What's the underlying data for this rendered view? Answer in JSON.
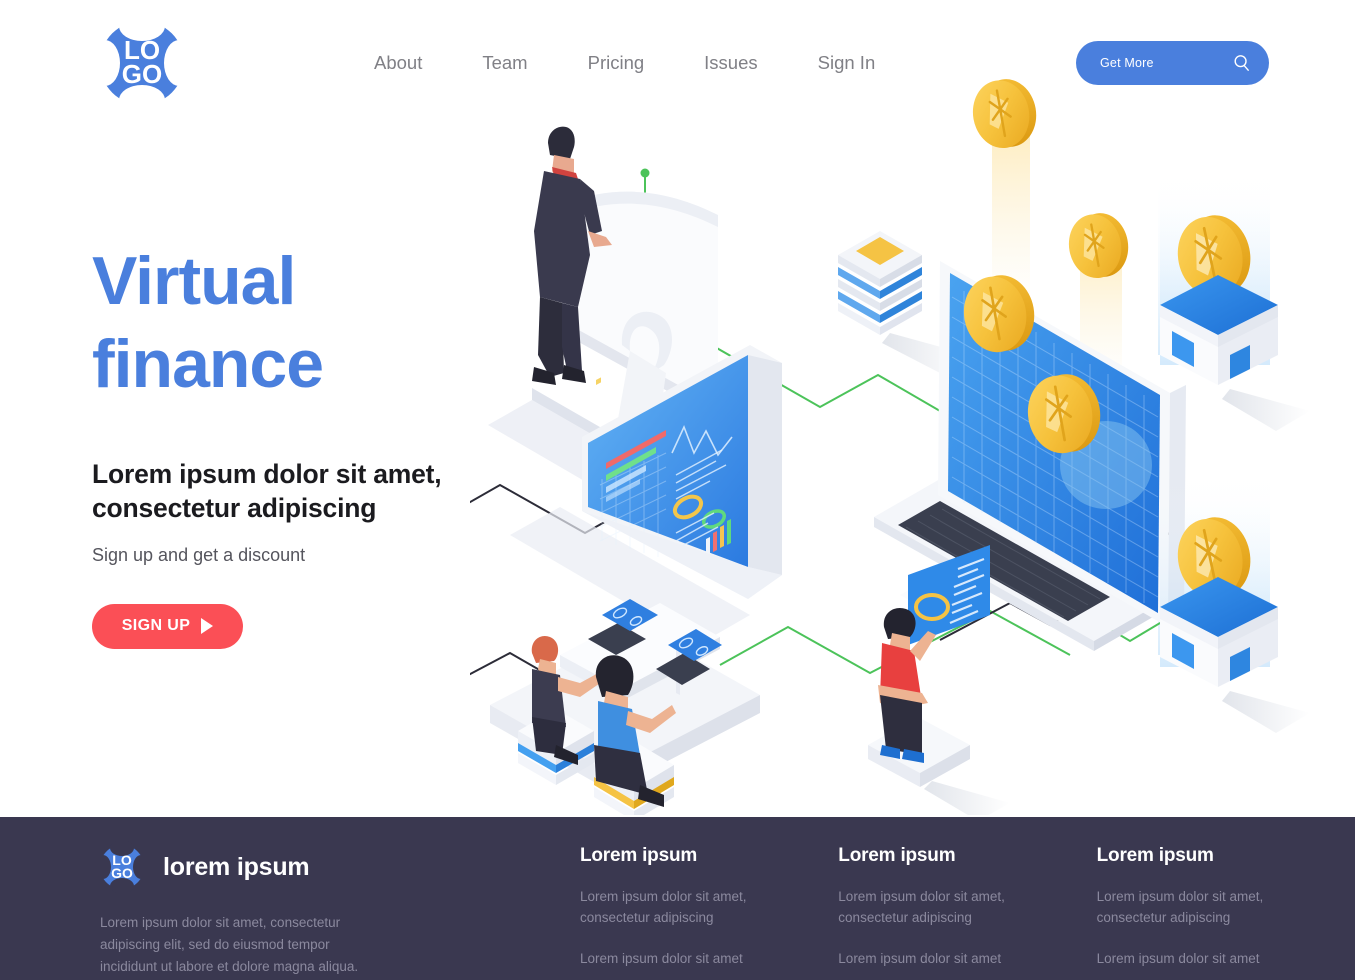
{
  "header": {
    "logo": {
      "line1": "LO",
      "line2": "GO",
      "name": "logo"
    },
    "nav": [
      {
        "label": "About"
      },
      {
        "label": "Team"
      },
      {
        "label": "Pricing"
      },
      {
        "label": "Issues"
      },
      {
        "label": "Sign In"
      }
    ],
    "cta": {
      "label": "Get More",
      "icon": "search-icon"
    }
  },
  "hero": {
    "title_line1": "Virtual",
    "title_line2": "finance",
    "subtitle_line1": "Lorem ipsum dolor sit amet,",
    "subtitle_line2": "consectetur adipiscing",
    "note": "Sign up and get a discount",
    "button": {
      "label": "SIGN UP",
      "icon": "play-icon"
    }
  },
  "illustration": {
    "name": "isometric-virtual-finance-illustration",
    "elements": [
      "desktop-monitor",
      "businessman-figure",
      "dashboard-screen",
      "laptop-with-coins",
      "gold-coins",
      "coin-platforms",
      "team-at-desk",
      "person-with-panel",
      "stacked-layers",
      "green-connector-lines",
      "black-connector-lines"
    ]
  },
  "footer": {
    "logo": {
      "line1": "LO",
      "line2": "GO"
    },
    "brand_name": "lorem ipsum",
    "brand_desc": "Lorem ipsum dolor sit amet, consectetur adipiscing elit, sed do eiusmod tempor incididunt ut labore et dolore magna aliqua.",
    "columns": [
      {
        "title": "Lorem ipsum",
        "links": [
          "Lorem ipsum dolor sit amet, consectetur adipiscing",
          "Lorem ipsum dolor sit amet"
        ]
      },
      {
        "title": "Lorem ipsum",
        "links": [
          "Lorem ipsum dolor sit amet, consectetur adipiscing",
          "Lorem ipsum dolor sit amet"
        ]
      },
      {
        "title": "Lorem ipsum",
        "links": [
          "Lorem ipsum dolor sit amet, consectetur adipiscing",
          "Lorem ipsum dolor sit amet"
        ]
      }
    ]
  },
  "colors": {
    "brand_blue": "#4a7fdd",
    "accent_red": "#fb4f56",
    "footer_bg": "#3a3850",
    "nav_gray": "#808086",
    "coin_gold": "#f5c242",
    "line_green": "#4cc35a"
  }
}
